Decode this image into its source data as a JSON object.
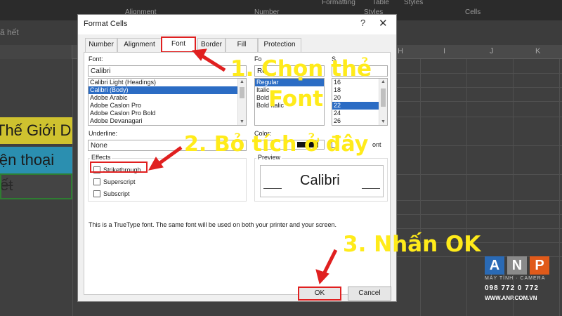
{
  "excel": {
    "ribbon_top": [
      "Formatting",
      "Table",
      "Styles"
    ],
    "ribbon_groups": [
      "Alignment",
      "Number",
      "Styles",
      "Cells"
    ],
    "formula_text": "ã hết",
    "columns": [
      "H",
      "I",
      "J",
      "K"
    ],
    "cells": {
      "yellow": "Thế Giới D",
      "blue": "iện thoại",
      "selected": "ết"
    }
  },
  "dialog": {
    "title": "Format Cells",
    "help_glyph": "?",
    "close_glyph": "✕",
    "tabs": [
      "Number",
      "Alignment",
      "Font",
      "Border",
      "Fill",
      "Protection"
    ],
    "active_tab": "Font",
    "font_label": "Font:",
    "font_value": "Calibri",
    "font_list": [
      "Calibri Light (Headings)",
      "Calibri (Body)",
      "Adobe Arabic",
      "Adobe Caslon Pro",
      "Adobe Caslon Pro Bold",
      "Adobe Devanagari"
    ],
    "font_selected": "Calibri (Body)",
    "style_label": "Fo",
    "style_value": "Re",
    "style_list": [
      "Regular",
      "Italic",
      "Bold",
      "Bold Italic"
    ],
    "style_selected": "Regular",
    "size_label": "S",
    "size_list": [
      "16",
      "18",
      "20",
      "22",
      "24",
      "26"
    ],
    "size_selected": "22",
    "underline_label": "Underline:",
    "underline_value": "None",
    "color_label": "Color:",
    "normal_font_label": "ont",
    "effects_label": "Effects",
    "strikethrough": "Strikethrough",
    "superscript": "Superscript",
    "subscript": "Subscript",
    "preview_label": "Preview",
    "preview_text": "Calibri",
    "info_text": "This is a TrueType font.  The same font will be used on both your printer and your screen.",
    "ok": "OK",
    "cancel": "Cancel"
  },
  "annotations": {
    "step1_line1": "1. Chọn thẻ",
    "step1_line2": "Font",
    "step2": "2. Bỏ tích ở đây",
    "step3": "3. Nhấn OK"
  },
  "logo": {
    "letters": [
      "A",
      "N",
      "P"
    ],
    "tagline": "MÁY TÍNH · CAMERA",
    "phone": "098 772 0 772",
    "website": "WWW.ANP.COM.VN",
    "colors": [
      "#2a6ab5",
      "#8a8a8a",
      "#e05a1a"
    ]
  }
}
